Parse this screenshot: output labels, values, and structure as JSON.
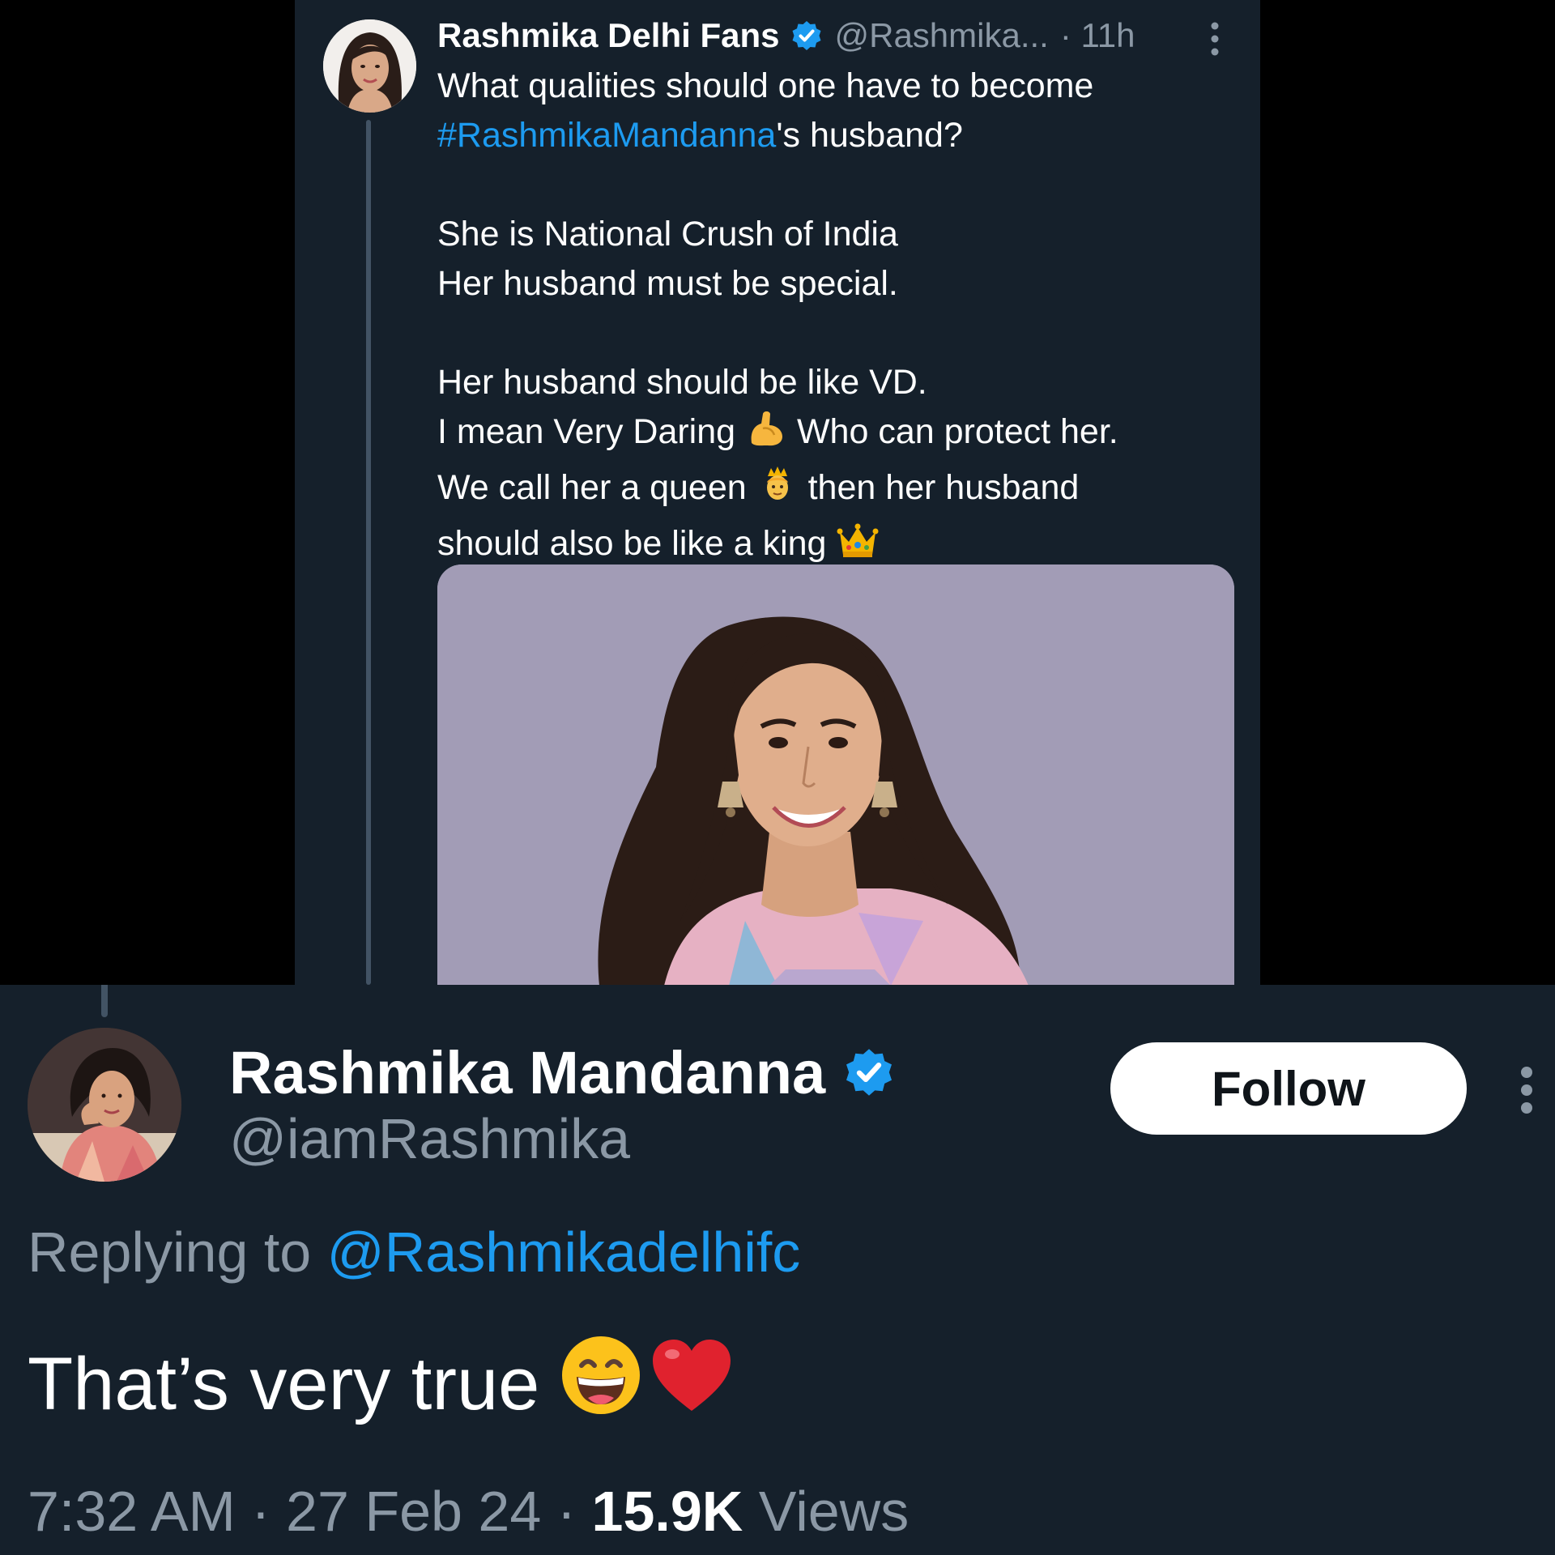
{
  "quoted_tweet": {
    "author_name": "Rashmika Delhi Fans",
    "author_handle": "@Rashmika...",
    "time": "· 11h",
    "line1": "What qualities should one have to become",
    "hashtag": "#RashmikaMandanna",
    "line2_suffix": "'s husband?",
    "line3": "She is National Crush of India",
    "line4": "Her husband must be special.",
    "line5": "Her husband should be like VD.",
    "line6_a": "I mean Very Daring",
    "line6_b": "Who can protect her.",
    "line7_a": "We call her a queen",
    "line7_b": "then her husband",
    "line8": "should also be like a king",
    "icons": [
      "verified-badge-icon",
      "more-options-icon",
      "flexed-biceps-emoji",
      "princess-emoji",
      "crown-emoji"
    ]
  },
  "reply_tweet": {
    "author_name": "Rashmika Mandanna",
    "author_handle": "@iamRashmika",
    "follow_label": "Follow",
    "replying_prefix": "Replying to",
    "replying_handle": "@Rashmikadelhifc",
    "text": "That’s very true",
    "time": "7:32 AM",
    "date": "27 Feb 24",
    "views_count": "15.9K",
    "views_label": "Views",
    "icons": [
      "verified-badge-icon",
      "more-options-icon",
      "grinning-emoji",
      "red-heart-emoji"
    ]
  },
  "colors": {
    "panel_bg": "#15202b",
    "outer_bg": "#000000",
    "link": "#1d9bf0",
    "secondary_text": "#8b98a5",
    "thread_line": "#425364"
  }
}
